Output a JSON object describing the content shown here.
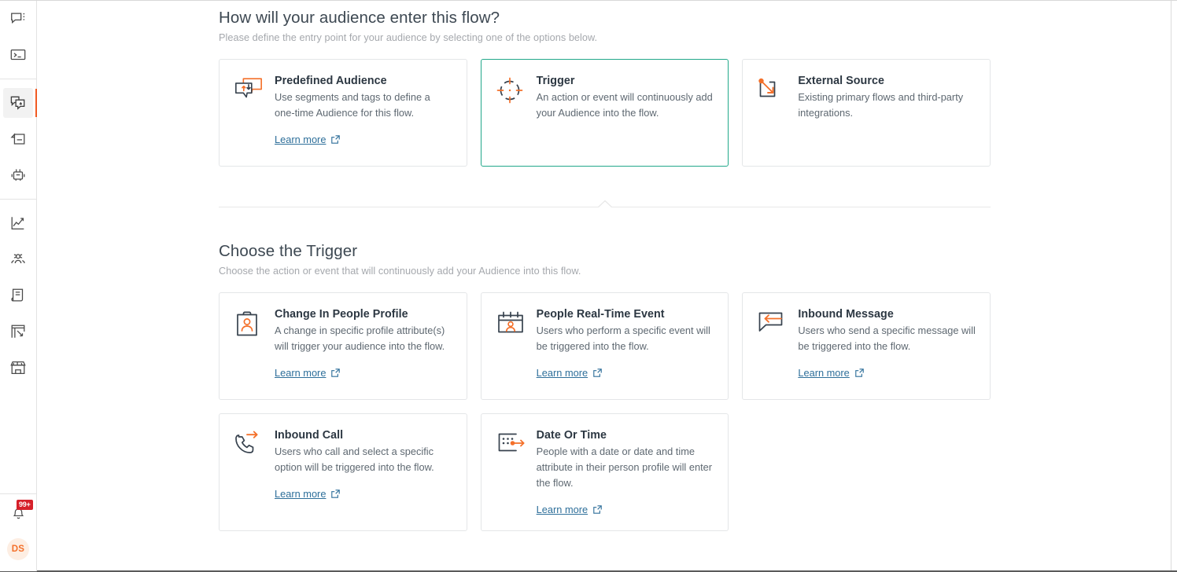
{
  "brand": {
    "accent_orange": "#f15a22",
    "selected_teal": "#22a88a",
    "link_blue": "#2e6f9a",
    "badge_red": "#d6202a"
  },
  "sidebar": {
    "groups": [
      {
        "items": [
          {
            "name": "conversations-icon",
            "label": "Conversations",
            "active": false
          },
          {
            "name": "console-icon",
            "label": "Console",
            "active": false
          }
        ]
      },
      {
        "items": [
          {
            "name": "flows-icon",
            "label": "Flows",
            "active": true
          },
          {
            "name": "campaigns-icon",
            "label": "Campaigns",
            "active": false
          },
          {
            "name": "bot-icon",
            "label": "Bots",
            "active": false
          }
        ]
      },
      {
        "items": [
          {
            "name": "analytics-icon",
            "label": "Analytics",
            "active": false
          },
          {
            "name": "people-icon",
            "label": "People",
            "active": false
          },
          {
            "name": "content-icon",
            "label": "Content",
            "active": false
          },
          {
            "name": "templates-icon",
            "label": "Templates",
            "active": false
          },
          {
            "name": "marketplace-icon",
            "label": "Marketplace",
            "active": false
          }
        ]
      }
    ],
    "notifications": {
      "icon": "bell-icon",
      "badge": "99+"
    },
    "avatar": {
      "initials": "DS"
    }
  },
  "entry": {
    "title": "How will your audience enter this flow?",
    "subtitle": "Please define the entry point for your audience by selecting one of the options below.",
    "options": [
      {
        "id": "predefined-audience",
        "icon": "predefined-audience-icon",
        "title": "Predefined Audience",
        "description": "Use segments and tags to define a one-time Audience for this flow.",
        "learn_more": "Learn more",
        "selected": false
      },
      {
        "id": "trigger",
        "icon": "trigger-target-icon",
        "title": "Trigger",
        "description": "An action or event will continuously add your Audience into the flow.",
        "learn_more": "",
        "selected": true
      },
      {
        "id": "external-source",
        "icon": "external-source-icon",
        "title": "External Source",
        "description": "Existing primary flows and third-party integrations.",
        "learn_more": "",
        "selected": false
      }
    ]
  },
  "trigger_section": {
    "title": "Choose the Trigger",
    "subtitle": "Choose the action or event that will continuously add your Audience into this flow.",
    "options_row1": [
      {
        "id": "change-in-people-profile",
        "icon": "profile-card-icon",
        "title": "Change In People Profile",
        "description": "A change in specific profile attribute(s) will trigger your audience into the flow.",
        "learn_more": "Learn more"
      },
      {
        "id": "people-real-time-event",
        "icon": "calendar-person-icon",
        "title": "People Real-Time Event",
        "description": "Users who perform a specific event will be triggered into the flow.",
        "learn_more": "Learn more"
      },
      {
        "id": "inbound-message",
        "icon": "inbound-message-icon",
        "title": "Inbound Message",
        "description": "Users who send a specific message will be triggered into the flow.",
        "learn_more": "Learn more"
      }
    ],
    "options_row2": [
      {
        "id": "inbound-call",
        "icon": "inbound-call-icon",
        "title": "Inbound Call",
        "description": "Users who call and select a specific option will be triggered into the flow.",
        "learn_more": "Learn more"
      },
      {
        "id": "date-or-time",
        "icon": "date-or-time-icon",
        "title": "Date Or Time",
        "description": "People with a date or date and time attribute in their person profile will enter the flow.",
        "learn_more": "Learn more"
      }
    ]
  }
}
